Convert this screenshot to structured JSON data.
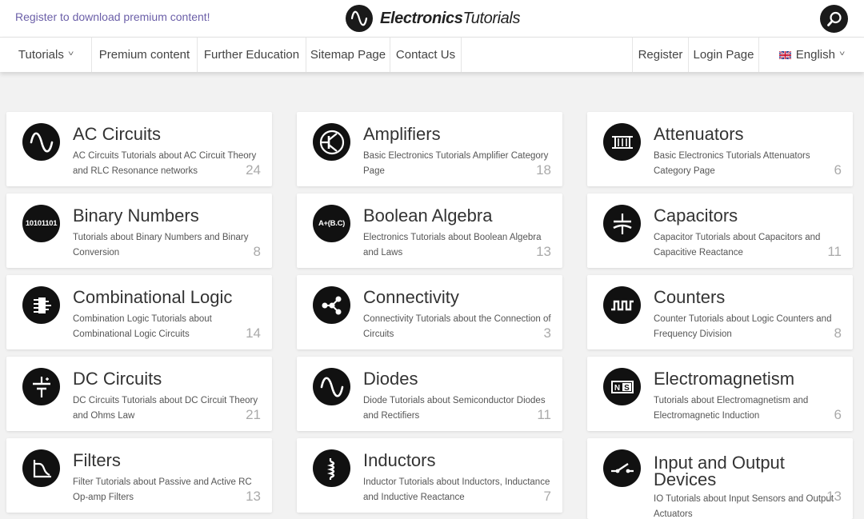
{
  "header": {
    "promo_link": "Register to download premium content!",
    "logo_brand_bold": "Electronics",
    "logo_brand_regular": "Tutorials",
    "search_icon": "search-icon"
  },
  "nav": {
    "left": [
      {
        "label": "Tutorials",
        "has_dropdown": true
      },
      {
        "label": "Premium content"
      },
      {
        "label": "Further Education"
      },
      {
        "label": "Sitemap Page"
      },
      {
        "label": "Contact Us"
      }
    ],
    "right": [
      {
        "label": "Register"
      },
      {
        "label": "Login Page"
      },
      {
        "label": "English",
        "has_dropdown": true,
        "icon": "uk-flag-icon"
      }
    ]
  },
  "categories": [
    {
      "title": "AC Circuits",
      "desc": "AC Circuits Tutorials about AC Circuit Theory and RLC Resonance networks",
      "count": "24",
      "icon": "sine-wave-icon"
    },
    {
      "title": "Amplifiers",
      "desc": "Basic Electronics Tutorials Amplifier Category Page",
      "count": "18",
      "icon": "transistor-icon"
    },
    {
      "title": "Attenuators",
      "desc": "Basic Electronics Tutorials Attenuators Category Page",
      "count": "6",
      "icon": "attenuator-icon"
    },
    {
      "title": "Binary Numbers",
      "desc": "Tutorials about Binary Numbers and Binary Conversion",
      "count": "8",
      "icon": "binary-icon",
      "icon_text": "10101101"
    },
    {
      "title": "Boolean Algebra",
      "desc": "Electronics Tutorials about Boolean Algebra and Laws",
      "count": "13",
      "icon": "boolean-icon",
      "icon_text": "A+(B.C)"
    },
    {
      "title": "Capacitors",
      "desc": "Capacitor Tutorials about Capacitors and Capacitive Reactance",
      "count": "11",
      "icon": "capacitor-icon"
    },
    {
      "title": "Combinational Logic",
      "desc": "Combination Logic Tutorials about Combinational Logic Circuits",
      "count": "14",
      "icon": "logic-chip-icon"
    },
    {
      "title": "Connectivity",
      "desc": "Connectivity Tutorials about the Connection of Circuits",
      "count": "3",
      "icon": "share-nodes-icon"
    },
    {
      "title": "Counters",
      "desc": "Counter Tutorials about Logic Counters and Frequency Division",
      "count": "8",
      "icon": "square-wave-icon"
    },
    {
      "title": "DC Circuits",
      "desc": "DC Circuits Tutorials about DC Circuit Theory and Ohms Law",
      "count": "21",
      "icon": "battery-icon"
    },
    {
      "title": "Diodes",
      "desc": "Diode Tutorials about Semiconductor Diodes and Rectifiers",
      "count": "11",
      "icon": "sine-wave-icon"
    },
    {
      "title": "Electromagnetism",
      "desc": "Tutorials about Electromagnetism and Electromagnetic Induction",
      "count": "6",
      "icon": "magnet-icon",
      "icon_text": "N S"
    },
    {
      "title": "Filters",
      "desc": "Filter Tutorials about Passive and Active RC Op-amp Filters",
      "count": "13",
      "icon": "filter-response-icon"
    },
    {
      "title": "Inductors",
      "desc": "Inductor Tutorials about Inductors, Inductance and Inductive Reactance",
      "count": "7",
      "icon": "coil-icon"
    },
    {
      "title": "Input and Output Devices",
      "desc": "IO Tutorials about Input Sensors and Output Actuators",
      "count": "13",
      "icon": "switch-icon"
    }
  ]
}
